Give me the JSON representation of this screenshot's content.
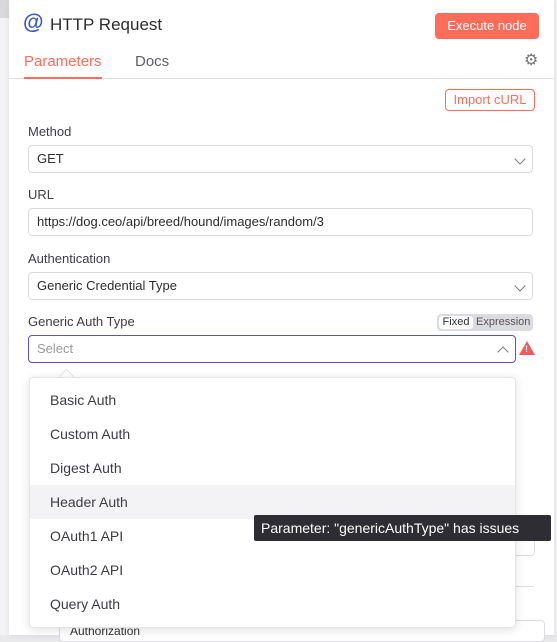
{
  "node": {
    "title": "HTTP Request",
    "execute_label": "Execute node",
    "icon": "at-icon"
  },
  "tabs": [
    {
      "label": "Parameters",
      "active": true
    },
    {
      "label": "Docs",
      "active": false
    }
  ],
  "import_label": "Import cURL",
  "fields": {
    "method": {
      "label": "Method",
      "value": "GET"
    },
    "url": {
      "label": "URL",
      "value": "https://dog.ceo/api/breed/hound/images/random/3"
    },
    "authentication": {
      "label": "Authentication",
      "value": "Generic Credential Type"
    },
    "generic_auth": {
      "label": "Generic Auth Type",
      "placeholder": "Select",
      "mode_fixed": "Fixed",
      "mode_expression": "Expression"
    }
  },
  "dropdown": {
    "options": [
      "Basic Auth",
      "Custom Auth",
      "Digest Auth",
      "Header Auth",
      "OAuth1 API",
      "OAuth2 API",
      "Query Auth"
    ],
    "hovered": "Header Auth"
  },
  "tooltip": "Parameter: \"genericAuthType\" has issues",
  "below": {
    "partial_text": "Authorization"
  },
  "colors": {
    "accent": "#ff6d5a",
    "focus": "#5a4fcf",
    "warning": "#f45959",
    "icon": "#3a58c5"
  }
}
